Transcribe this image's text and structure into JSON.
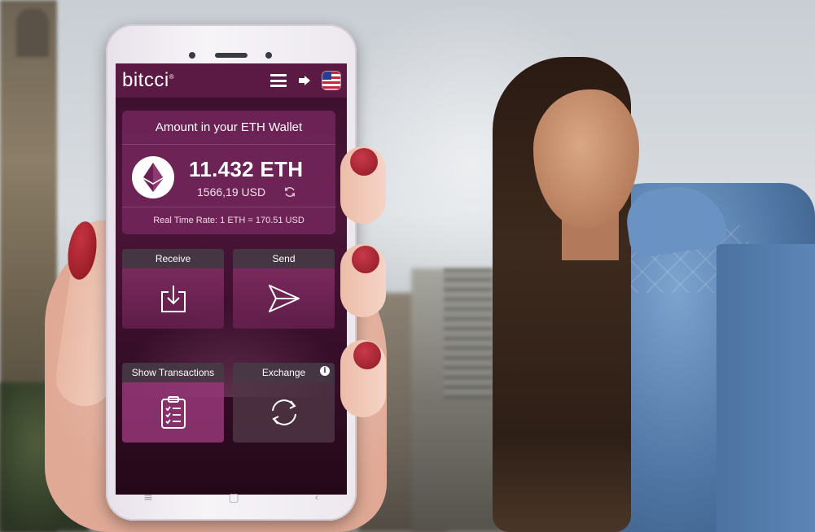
{
  "app": {
    "logo_text": "bitcci",
    "logo_mark": "®"
  },
  "header": {
    "icons": [
      "menu-icon",
      "logout-icon",
      "us-flag-icon"
    ]
  },
  "wallet": {
    "title": "Amount in your ETH Wallet",
    "eth_amount": "11.432 ETH",
    "usd_amount": "1566,19 USD",
    "rate": "Real Time Rate: 1 ETH = 170.51 USD"
  },
  "actions": {
    "receive": "Receive",
    "send": "Send",
    "show_transactions": "Show Transactions",
    "exchange": "Exchange",
    "info_glyph": "i"
  },
  "phone_nav": {
    "menu_glyph": "≡",
    "home_glyph": "▢",
    "back_glyph": "‹"
  },
  "colors": {
    "topbar": "#5a1a43",
    "screen_bg": "#3a0f2c",
    "card_bg": "#7a285f",
    "accent_white": "#ffffff"
  }
}
